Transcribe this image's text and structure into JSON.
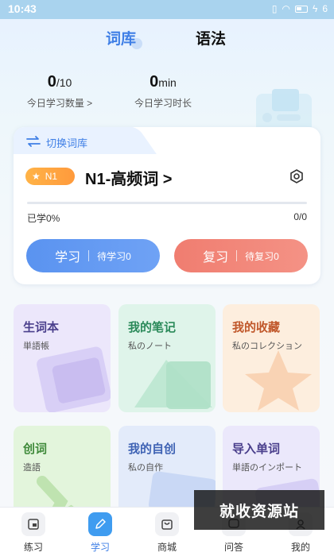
{
  "status_bar": {
    "time": "10:43",
    "battery": "6"
  },
  "tabs": [
    {
      "label": "词库"
    },
    {
      "label": "语法"
    }
  ],
  "stats": {
    "words": {
      "value": "0",
      "unit": "/10",
      "label": "今日学习数量 >"
    },
    "time": {
      "value": "0",
      "unit": "min",
      "label": "今日学习时长"
    }
  },
  "card": {
    "switch_label": "切换词库",
    "badge": "N1",
    "title": "N1-高频词 >",
    "learned": "已学0%",
    "ratio": "0/0",
    "progress": 0,
    "study_button": {
      "label": "学习",
      "sub": "待学习0"
    },
    "review_button": {
      "label": "复习",
      "sub": "待复习0"
    }
  },
  "tiles": [
    {
      "title": "生词本",
      "subtitle": "単語帳"
    },
    {
      "title": "我的笔记",
      "subtitle": "私のノート"
    },
    {
      "title": "我的收藏",
      "subtitle": "私のコレクション"
    },
    {
      "title": "创词",
      "subtitle": "造語"
    },
    {
      "title": "我的自创",
      "subtitle": "私の自作"
    },
    {
      "title": "导入单词",
      "subtitle": "単語のインポート"
    }
  ],
  "nav": [
    {
      "label": "练习",
      "icon": "practice-icon"
    },
    {
      "label": "学习",
      "icon": "study-icon"
    },
    {
      "label": "商城",
      "icon": "shop-icon"
    },
    {
      "label": "问答",
      "icon": "qa-icon"
    },
    {
      "label": "我的",
      "icon": "profile-icon"
    }
  ],
  "watermark": "就收资源站",
  "colors": {
    "accent": "#3f7fe6",
    "study": "#5a93f0",
    "review": "#f07d70",
    "badge": "#ff9a3c"
  }
}
